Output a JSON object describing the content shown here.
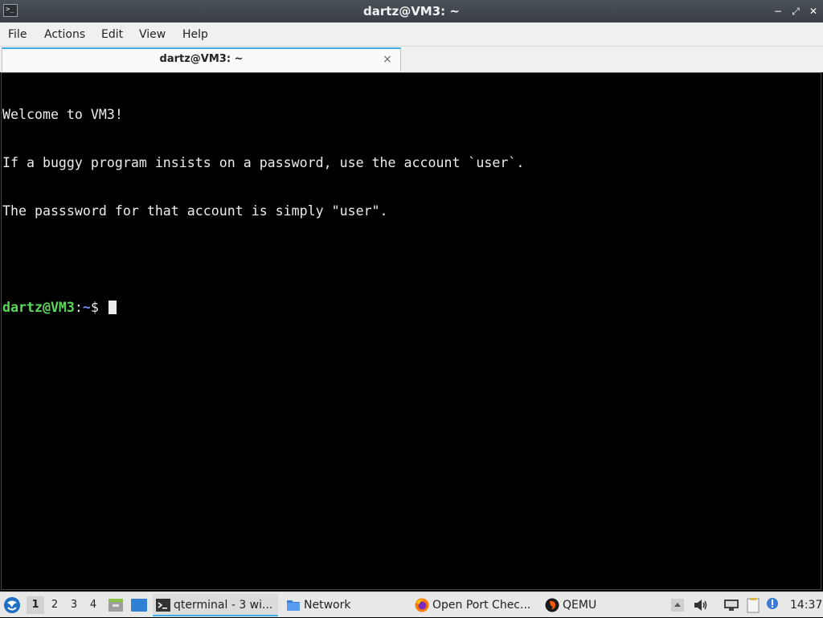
{
  "window": {
    "title": "dartz@VM3: ~",
    "app_icon_glyph": ">_",
    "controls": {
      "minimize": "−",
      "restore": "⤢",
      "close": "✕"
    }
  },
  "menubar": {
    "items": [
      "File",
      "Actions",
      "Edit",
      "View",
      "Help"
    ]
  },
  "tabs": [
    {
      "label": "dartz@VM3: ~",
      "close": "×"
    }
  ],
  "terminal": {
    "lines": [
      "Welcome to VM3!",
      "If a buggy program insists on a password, use the account `user`.",
      "The passsword for that account is simply \"user\".",
      ""
    ],
    "prompt": {
      "user_host": "dartz@VM3",
      "colon": ":",
      "path": "~",
      "symbol": "$ "
    },
    "colors": {
      "background": "#000000",
      "text": "#ececec",
      "user_host": "#5ad85a",
      "path": "#7a86ff"
    }
  },
  "taskbar": {
    "desktops": [
      "1",
      "2",
      "3",
      "4"
    ],
    "active_desktop": "1",
    "tasks": [
      {
        "label": "qterminal - 3 wi...",
        "icon": "terminal-icon",
        "active": true
      },
      {
        "label": "Network",
        "icon": "folder-icon",
        "active": false
      },
      {
        "label": "Open Port Chec...",
        "icon": "firefox-icon",
        "active": false
      },
      {
        "label": "QEMU",
        "icon": "qemu-icon",
        "active": false
      }
    ],
    "clock": "14:37",
    "accent": "#3daee9"
  }
}
